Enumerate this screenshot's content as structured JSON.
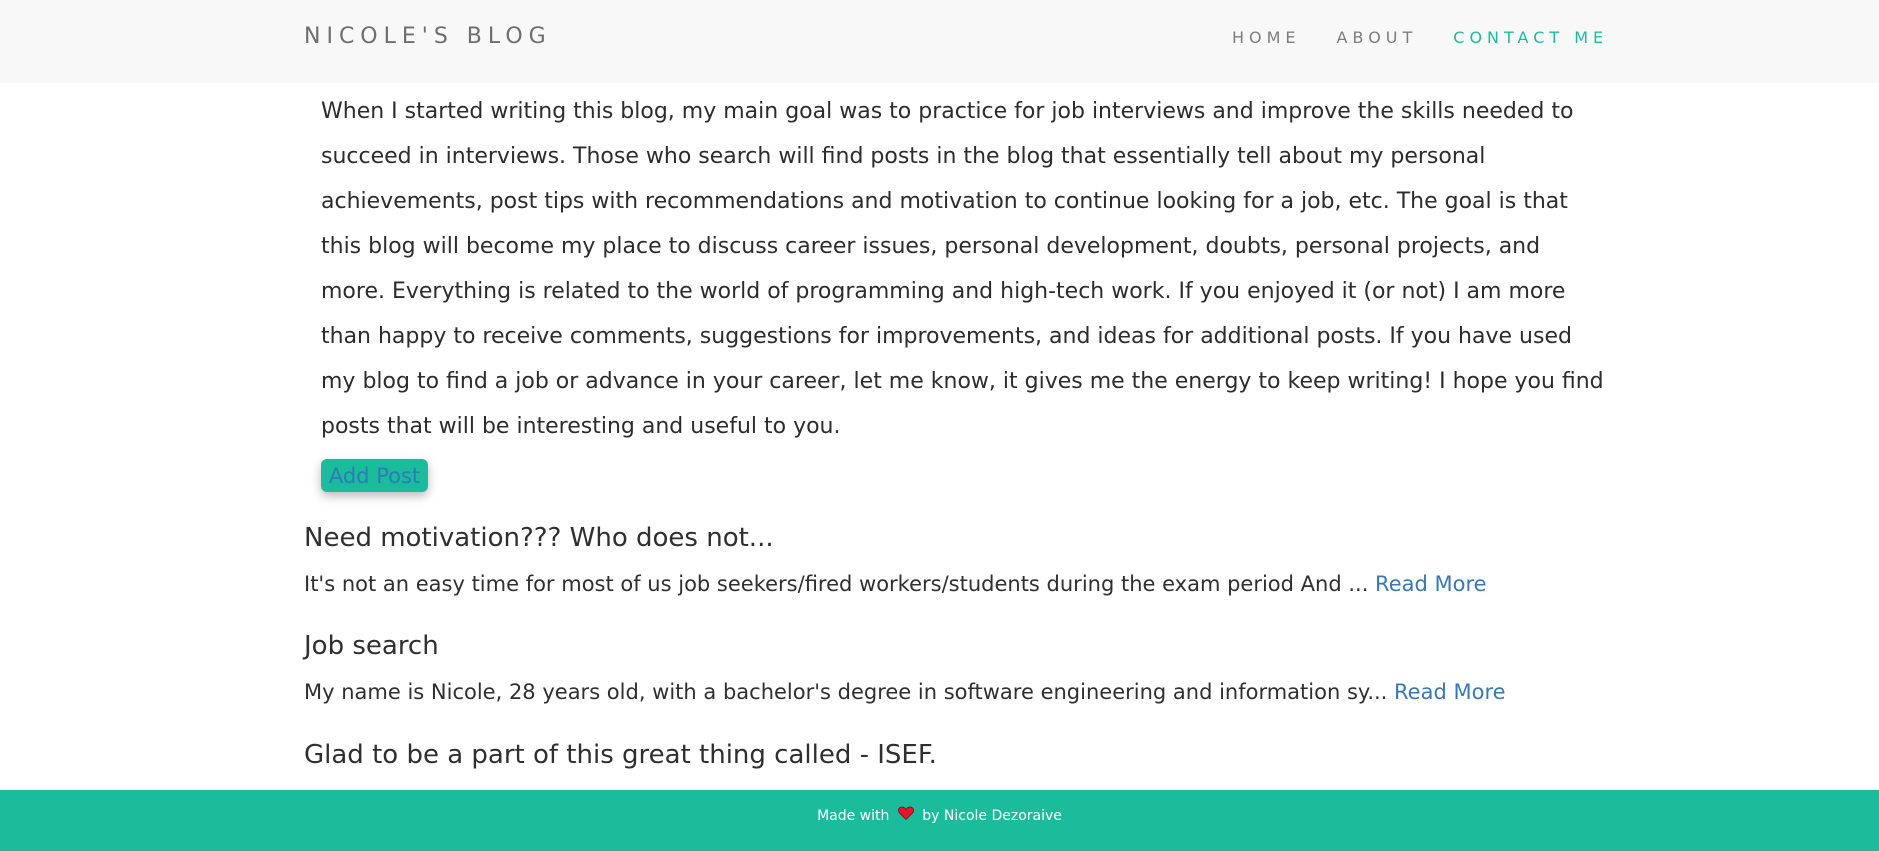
{
  "navbar": {
    "brand": "NICOLE'S BLOG",
    "links": [
      {
        "label": "HOME",
        "active": false
      },
      {
        "label": "ABOUT",
        "active": false
      },
      {
        "label": "CONTACT ME",
        "active": true
      }
    ]
  },
  "intro": {
    "text": "When I started writing this blog, my main goal was to practice for job interviews and improve the skills needed to succeed in interviews. Those who search will find posts in the blog that essentially tell about my personal achievements, post tips with recommendations and motivation to continue looking for a job, etc. The goal is that this blog will become my place to discuss career issues, personal development, doubts, personal projects, and more. Everything is related to the world of programming and high-tech work. If you enjoyed it (or not) I am more than happy to receive comments, suggestions for improvements, and ideas for additional posts. If you have used my blog to find a job or advance in your career, let me know, it gives me the energy to keep writing! I hope you find posts that will be interesting and useful to you."
  },
  "add_post_label": "Add Post",
  "posts": [
    {
      "title": "Need motivation??? Who does not...",
      "excerpt": "It's not an easy time for most of us job seekers/fired workers/students during the exam period And ... ",
      "read_more": "Read More"
    },
    {
      "title": "Job search",
      "excerpt": "My name is Nicole, 28 years old, with a bachelor's degree in software engineering and information sy... ",
      "read_more": "Read More"
    },
    {
      "title": "Glad to be a part of this great thing called - ISEF."
    }
  ],
  "footer": {
    "made_with": "Made with",
    "by": "by Nicole Dezoraive",
    "heart_icon": "heart-icon",
    "heart_color": "#e3172d"
  },
  "colors": {
    "accent": "#1abc9c",
    "link": "#3a78b4",
    "navbar_bg": "#f8f8f8"
  }
}
